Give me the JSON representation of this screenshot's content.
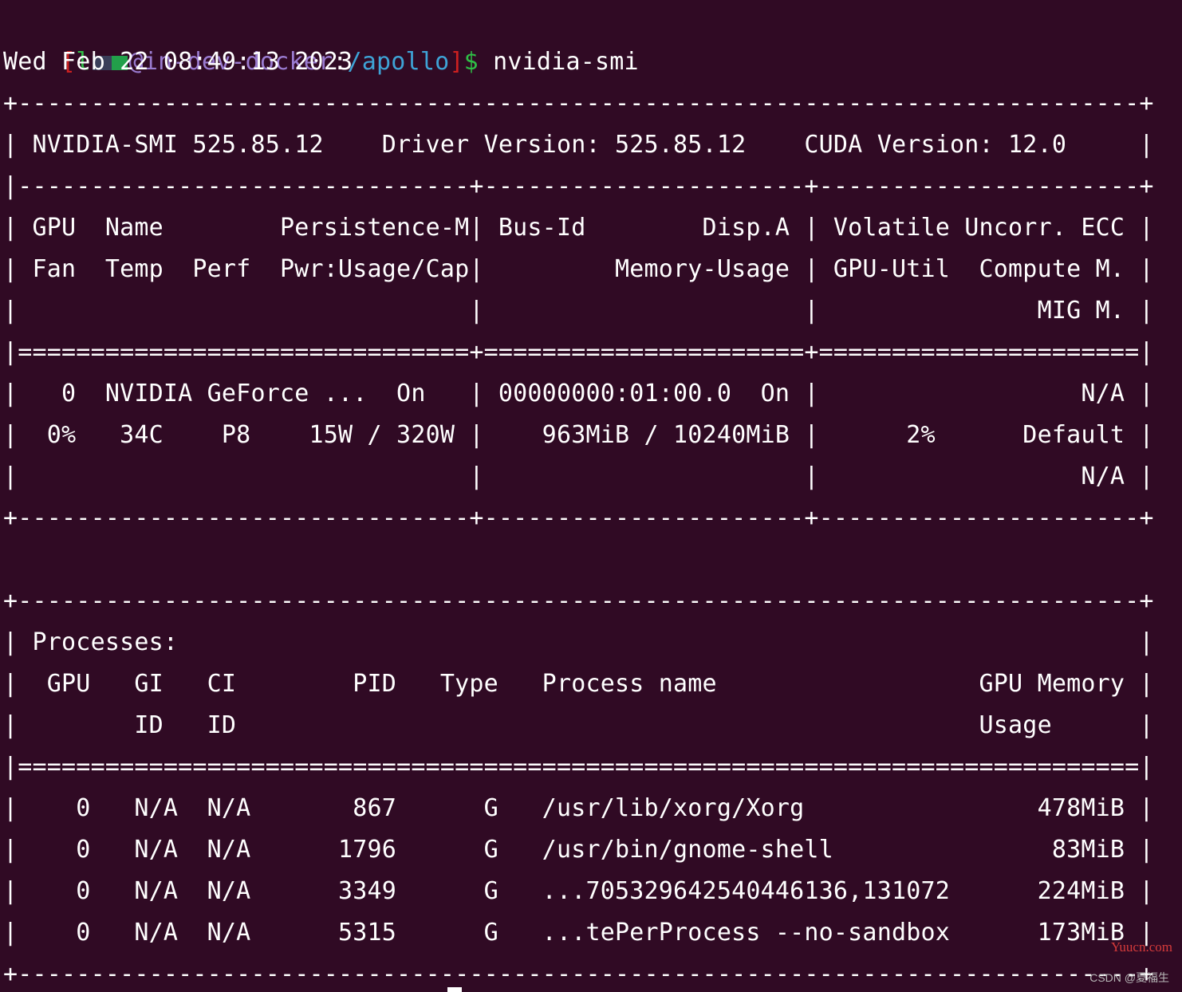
{
  "prompt": {
    "bracket_open": "[",
    "user_fragment": "l",
    "host": "@in-dev-docker",
    "colon": ":",
    "path": "/apollo",
    "bracket_close": "]",
    "dollar": "$",
    "command": " nvidia-smi"
  },
  "output_lines": [
    "Wed Feb 22 08:49:13 2023",
    "+-----------------------------------------------------------------------------+",
    "| NVIDIA-SMI 525.85.12    Driver Version: 525.85.12    CUDA Version: 12.0     |",
    "|-------------------------------+----------------------+----------------------+",
    "| GPU  Name        Persistence-M| Bus-Id        Disp.A | Volatile Uncorr. ECC |",
    "| Fan  Temp  Perf  Pwr:Usage/Cap|         Memory-Usage | GPU-Util  Compute M. |",
    "|                               |                      |               MIG M. |",
    "|===============================+======================+======================|",
    "|   0  NVIDIA GeForce ...  On   | 00000000:01:00.0  On |                  N/A |",
    "|  0%   34C    P8    15W / 320W |    963MiB / 10240MiB |      2%      Default |",
    "|                               |                      |                  N/A |",
    "+-------------------------------+----------------------+----------------------+",
    "",
    "+-----------------------------------------------------------------------------+",
    "| Processes:                                                                  |",
    "|  GPU   GI   CI        PID   Type   Process name                  GPU Memory |",
    "|        ID   ID                                                   Usage      |",
    "|=============================================================================|",
    "|    0   N/A  N/A       867      G   /usr/lib/xorg/Xorg                478MiB |",
    "|    0   N/A  N/A      1796      G   /usr/bin/gnome-shell               83MiB |",
    "|    0   N/A  N/A      3349      G   ...705329642540446136,131072      224MiB |",
    "|    0   N/A  N/A      5315      G   ...tePerProcess --no-sandbox      173MiB |",
    "+-----------------------------------------------------------------------------+"
  ],
  "watermark": "Yuucn.com",
  "csdn_credit": "CSDN @夏福生",
  "colors": {
    "background": "#300a24",
    "text": "#ffffff",
    "prompt_user": "#9a7bd0",
    "prompt_path": "#3ea3d6",
    "prompt_symbol": "#2fbf46",
    "bracket": "#cc2020"
  }
}
